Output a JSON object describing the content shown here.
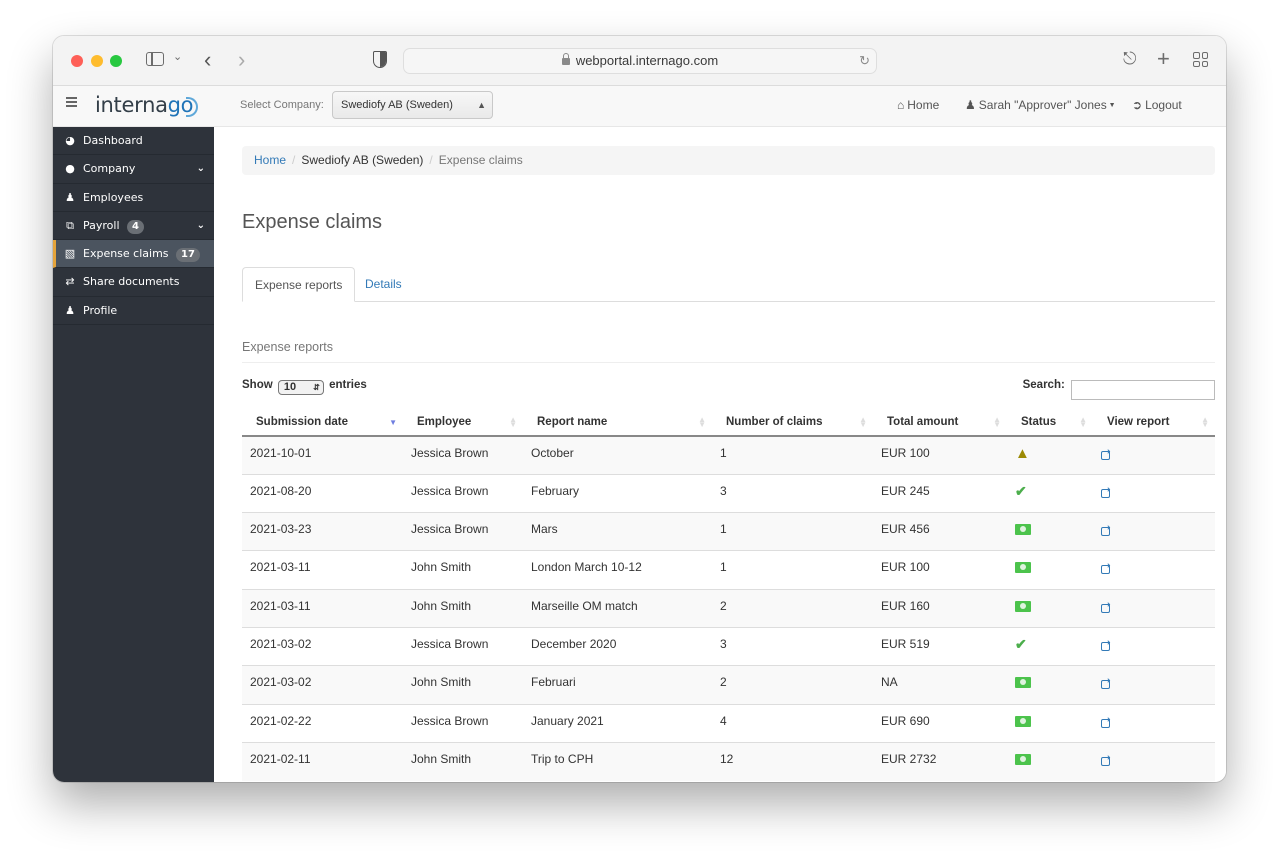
{
  "browser": {
    "url": "webportal.internago.com",
    "icons": [
      "sidebar-toggle-icon",
      "chevron-down-icon",
      "back-icon",
      "forward-icon",
      "privacy-shield-icon",
      "lock-icon",
      "reload-icon",
      "share-icon",
      "new-tab-icon",
      "tab-overview-icon"
    ]
  },
  "header": {
    "logo_text": "interna",
    "logo_accent": "go",
    "company_label": "Select Company:",
    "company_selected": "Swediofy AB (Sweden)",
    "nav": {
      "home": "Home",
      "user": "Sarah \"Approver\" Jones",
      "logout": "Logout"
    }
  },
  "sidebar": {
    "items": [
      {
        "label": "Dashboard",
        "icon": "dashboard-icon",
        "badge": null,
        "expandable": false,
        "active": false
      },
      {
        "label": "Company",
        "icon": "globe-icon",
        "badge": null,
        "expandable": true,
        "active": false
      },
      {
        "label": "Employees",
        "icon": "users-icon",
        "badge": null,
        "expandable": false,
        "active": false
      },
      {
        "label": "Payroll",
        "icon": "payroll-icon",
        "badge": "4",
        "expandable": true,
        "active": false
      },
      {
        "label": "Expense claims",
        "icon": "book-icon",
        "badge": "17",
        "expandable": false,
        "active": true
      },
      {
        "label": "Share documents",
        "icon": "exchange-icon",
        "badge": null,
        "expandable": false,
        "active": false
      },
      {
        "label": "Profile",
        "icon": "user-icon",
        "badge": null,
        "expandable": false,
        "active": false
      }
    ],
    "accent_color": "#e5a43b"
  },
  "breadcrumb": {
    "home": "Home",
    "company": "Swediofy AB (Sweden)",
    "current": "Expense claims"
  },
  "page": {
    "title": "Expense claims",
    "tabs": [
      {
        "label": "Expense reports",
        "active": true
      },
      {
        "label": "Details",
        "active": false
      }
    ],
    "section_title": "Expense reports"
  },
  "table_controls": {
    "show_label": "Show",
    "entries_value": "10",
    "entries_label": "entries",
    "search_label": "Search:",
    "search_value": ""
  },
  "table": {
    "columns": [
      "Submission date",
      "Employee",
      "Report name",
      "Number of claims",
      "Total amount",
      "Status",
      "View report"
    ],
    "sorted_column": "Submission date",
    "sort_direction": "desc",
    "rows": [
      {
        "date": "2021-10-01",
        "employee": "Jessica Brown",
        "report": "October",
        "claims": "1",
        "amount": "EUR 100",
        "status": "warning"
      },
      {
        "date": "2021-08-20",
        "employee": "Jessica Brown",
        "report": "February",
        "claims": "3",
        "amount": "EUR 245",
        "status": "approved"
      },
      {
        "date": "2021-03-23",
        "employee": "Jessica Brown",
        "report": "Mars",
        "claims": "1",
        "amount": "EUR 456",
        "status": "paid"
      },
      {
        "date": "2021-03-11",
        "employee": "John Smith",
        "report": "London March 10-12",
        "claims": "1",
        "amount": "EUR 100",
        "status": "paid"
      },
      {
        "date": "2021-03-11",
        "employee": "John Smith",
        "report": "Marseille OM match",
        "claims": "2",
        "amount": "EUR 160",
        "status": "paid"
      },
      {
        "date": "2021-03-02",
        "employee": "Jessica Brown",
        "report": "December 2020",
        "claims": "3",
        "amount": "EUR 519",
        "status": "approved"
      },
      {
        "date": "2021-03-02",
        "employee": "John Smith",
        "report": "Februari",
        "claims": "2",
        "amount": "NA",
        "status": "paid"
      },
      {
        "date": "2021-02-22",
        "employee": "Jessica Brown",
        "report": "January 2021",
        "claims": "4",
        "amount": "EUR 690",
        "status": "paid"
      },
      {
        "date": "2021-02-11",
        "employee": "John Smith",
        "report": "Trip to CPH",
        "claims": "12",
        "amount": "EUR 2732",
        "status": "paid"
      }
    ],
    "status_icons": {
      "warning": "warning-triangle-icon",
      "approved": "check-icon",
      "paid": "money-icon"
    },
    "status_colors": {
      "warning": "#9c8a05",
      "approved": "#4cae4c",
      "paid": "#4cc34c"
    }
  }
}
